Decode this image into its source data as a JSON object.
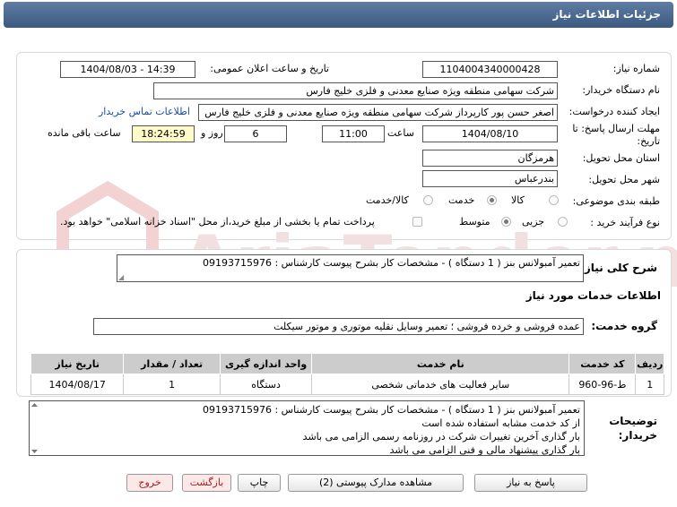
{
  "header": {
    "title": "جزئیات اطلاعات نیاز"
  },
  "form": {
    "need_number_label": "شماره نیاز:",
    "need_number": "1104004340000428",
    "announce_label": "تاریخ و ساعت اعلان عمومی:",
    "announce_value": "1404/08/03 - 14:39",
    "buyer_org_label": "نام دستگاه خریدار:",
    "buyer_org": "شرکت سهامی منطقه ویژه صنایع معدنی و فلزی خلیج فارس",
    "creator_label": "ایجاد کننده درخواست:",
    "creator": "اصغر حسن پور کارپرداز شرکت سهامی منطقه ویژه صنایع معدنی و فلزی خلیج فارس",
    "contact_link": "اطلاعات تماس خریدار",
    "deadline_label": "مهلت ارسال پاسخ: تا تاریخ:",
    "deadline_date": "1404/08/10",
    "time_label": "ساعت",
    "deadline_time": "11:00",
    "days": "6",
    "days_label": "روز و",
    "remaining": "18:24:59",
    "remaining_label": "ساعت باقی مانده",
    "province_label": "استان محل تحویل:",
    "province": "هرمزگان",
    "city_label": "شهر محل تحویل:",
    "city": "بندرعباس",
    "category_label": "طبقه بندی موضوعی:",
    "category_options": [
      "کالا",
      "خدمت",
      "کالا/خدمت"
    ],
    "category_selected": "خدمت",
    "process_label": "نوع فرآیند خرید :",
    "process_options": [
      "جزیی",
      "متوسط"
    ],
    "process_selected": "متوسط",
    "payment_note": "پرداخت تمام یا بخشی از مبلغ خرید،از محل \"اسناد خزانه اسلامی\" خواهد بود."
  },
  "summary": {
    "label": "شرح کلی نیاز:",
    "value": "تعمیر آمبولانس بنز  ( 1 دستگاه ) - مشخصات کار بشرح پیوست  کارشناس : 09193715976"
  },
  "services": {
    "section_title": "اطلاعات خدمات مورد نیاز",
    "group_label": "گروه خدمت:",
    "group_value": "عمده فروشی و خرده فروشی ؛ تعمیر وسایل نقلیه موتوری و موتور سیکلت"
  },
  "table": {
    "headers": [
      "ردیف",
      "کد خدمت",
      "نام خدمت",
      "واحد اندازه گیری",
      "تعداد / مقدار",
      "تاریخ نیاز"
    ],
    "rows": [
      [
        "1",
        "ط-96-960",
        "سایر فعالیت های خدماتی شخصی",
        "دستگاه",
        "1",
        "1404/08/17"
      ]
    ]
  },
  "notes": {
    "label": "توضیحات خریدار:",
    "lines": [
      "تعمیر آمبولانس بنز  ( 1 دستگاه ) - مشخصات کار بشرح پیوست  کارشناس : 09193715976",
      "از کد خدمت مشابه استفاده شده است",
      "بار گذاری آخرین تغییرات شرکت در روزنامه رسمی الزامی می باشد",
      "بار گذاری پیشنهاد مالی و فنی الزامی می باشد"
    ]
  },
  "buttons": {
    "reply": "پاسخ به نیاز",
    "attachments": "مشاهده مدارک پیوستی (2)",
    "print": "چاپ",
    "back": "بازگشت",
    "exit": "خروج"
  },
  "colors": {
    "header": "#4a6a90",
    "link": "#1a4fa0",
    "remaining_bg": "#fffbc9"
  }
}
